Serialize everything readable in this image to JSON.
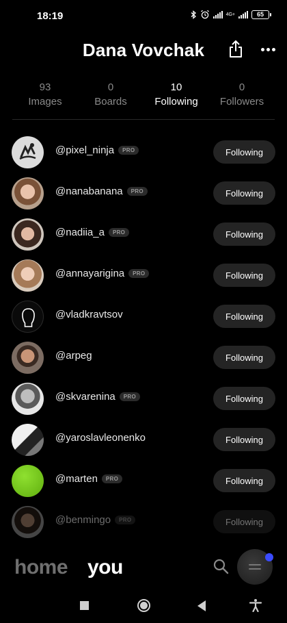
{
  "status": {
    "time": "18:19",
    "network": "4G+",
    "battery": "65"
  },
  "header": {
    "title": "Dana Vovchak",
    "share_icon": "share-icon",
    "more_icon": "more-icon"
  },
  "stats": [
    {
      "count": "93",
      "label": "Images"
    },
    {
      "count": "0",
      "label": "Boards"
    },
    {
      "count": "10",
      "label": "Following"
    },
    {
      "count": "0",
      "label": "Followers"
    }
  ],
  "following": [
    {
      "username": "@pixel_ninja",
      "pro": "PRO",
      "button": "Following"
    },
    {
      "username": "@nanabanana",
      "pro": "PRO",
      "button": "Following"
    },
    {
      "username": "@nadiia_a",
      "pro": "PRO",
      "button": "Following"
    },
    {
      "username": "@annayarigina",
      "pro": "PRO",
      "button": "Following"
    },
    {
      "username": "@vladkravtsov",
      "pro": "",
      "button": "Following"
    },
    {
      "username": "@arpeg",
      "pro": "",
      "button": "Following"
    },
    {
      "username": "@skvarenina",
      "pro": "PRO",
      "button": "Following"
    },
    {
      "username": "@yaroslavleonenko",
      "pro": "",
      "button": "Following"
    },
    {
      "username": "@marten",
      "pro": "PRO",
      "button": "Following"
    },
    {
      "username": "@benmingo",
      "pro": "PRO",
      "button": "Following"
    }
  ],
  "nav": {
    "home": "home",
    "you": "you"
  },
  "colors": {
    "background": "#000000",
    "button_bg": "#242424",
    "muted_text": "#8a8a8a",
    "notification_dot": "#3a4bff",
    "green_avatar": "#7ed321"
  }
}
